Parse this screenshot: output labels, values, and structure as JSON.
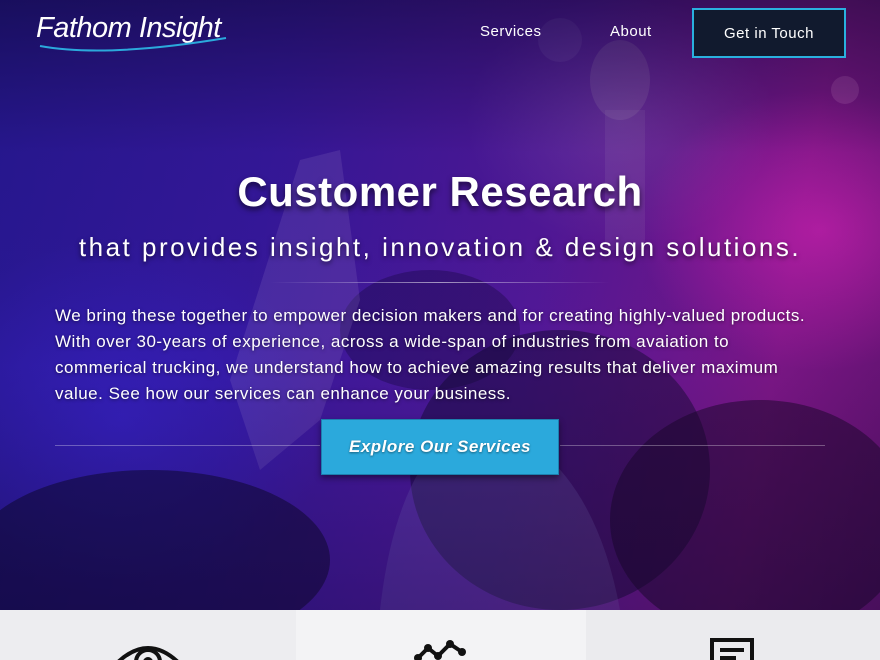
{
  "brand": {
    "name": "Fathom Insight",
    "accent_color": "#2ba9dc",
    "hero_gradient": [
      "#2a1a9e",
      "#5a1aa4",
      "#86188f"
    ]
  },
  "nav": {
    "links": [
      {
        "label": "Services"
      },
      {
        "label": "About"
      }
    ],
    "cta_label": "Get in Touch"
  },
  "hero": {
    "title": "Customer Research",
    "subtitle": "that provides insight, innovation & design solutions.",
    "body": "We bring these together to empower decision makers and for creating highly-valued products. With over 30-years of experience, across a wide-span of industries from avaiation to commerical trucking, we understand how to achieve amazing results that deliver maximum value. See how our services can enhance your business.",
    "cta_label": "Explore Our Services"
  },
  "cards": [
    {
      "icon": "eye-icon"
    },
    {
      "icon": "chart-icon"
    },
    {
      "icon": "document-icon"
    }
  ]
}
